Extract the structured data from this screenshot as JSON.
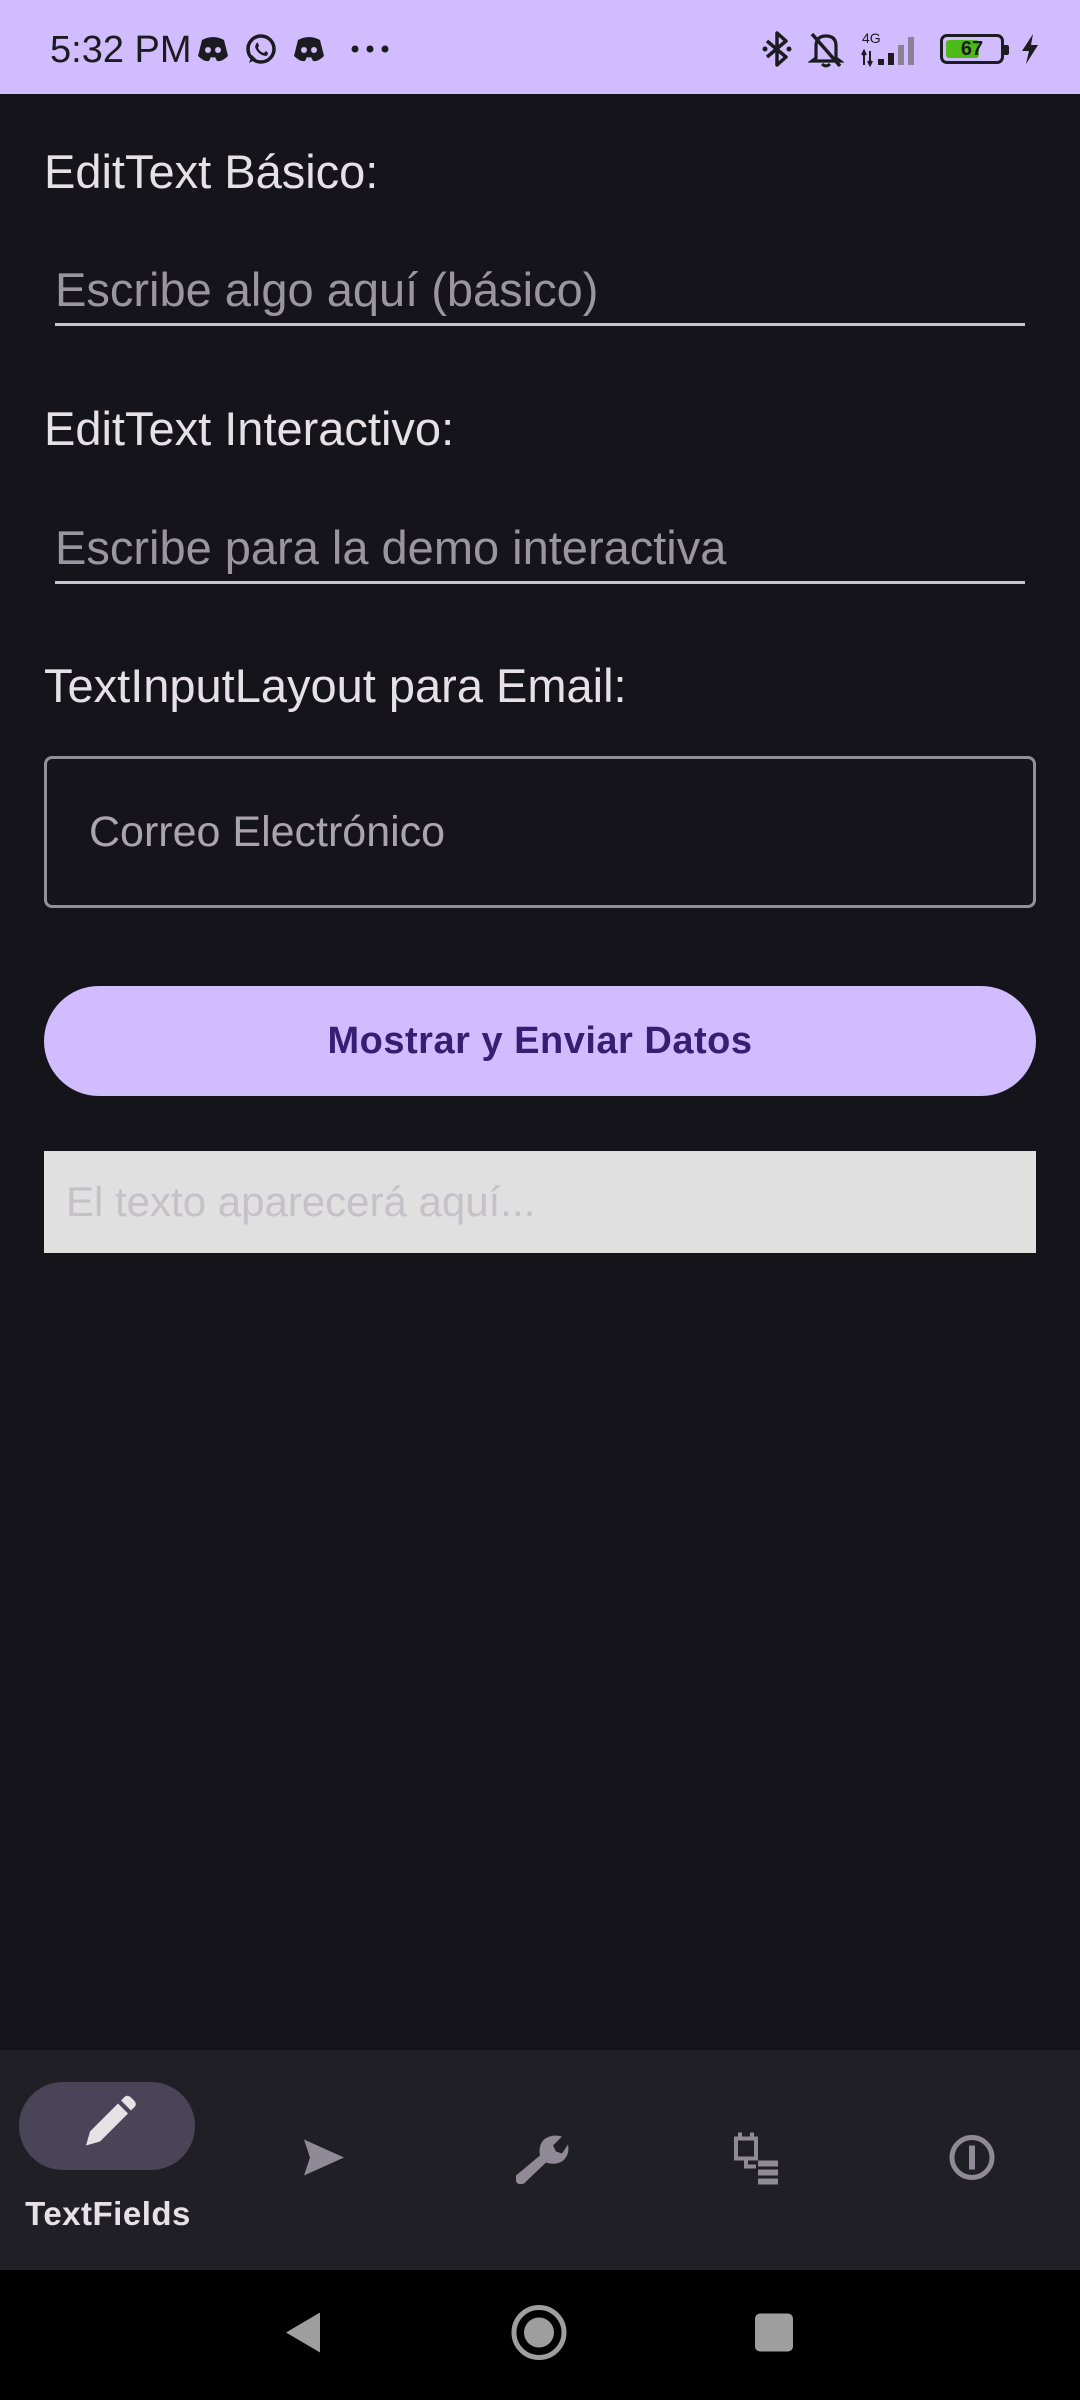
{
  "status_bar": {
    "time": "5:32 PM",
    "left_icons": [
      "discord-icon",
      "whatsapp-icon",
      "discord-icon",
      "more-dots-icon"
    ],
    "network_label": "4G",
    "battery_level": "67",
    "battery_fraction": 0.67,
    "battery_color": "#4cbb17"
  },
  "basic_edit": {
    "label": "EditText Básico:",
    "placeholder": "Escribe algo aquí (básico)"
  },
  "interactive_edit": {
    "label": "EditText Interactivo:",
    "placeholder": "Escribe para la demo interactiva"
  },
  "email_field": {
    "label": "TextInputLayout para Email:",
    "hint": "Correo Electrónico"
  },
  "submit_button": {
    "label": "Mostrar y Enviar Datos"
  },
  "output": {
    "text": "El texto aparecerá aquí..."
  },
  "bottom_nav": {
    "items": [
      {
        "icon": "pencil-icon",
        "label": "TextFields",
        "selected": true
      },
      {
        "icon": "send-icon",
        "label": "",
        "selected": false
      },
      {
        "icon": "wrench-icon",
        "label": "",
        "selected": false
      },
      {
        "icon": "widgets-list-icon",
        "label": "",
        "selected": false
      },
      {
        "icon": "info-icon",
        "label": "",
        "selected": false
      }
    ]
  },
  "theme": {
    "accent": "#d0bcfe",
    "background": "#16141b",
    "nav_background": "#211f26",
    "button_text": "#381e72"
  }
}
